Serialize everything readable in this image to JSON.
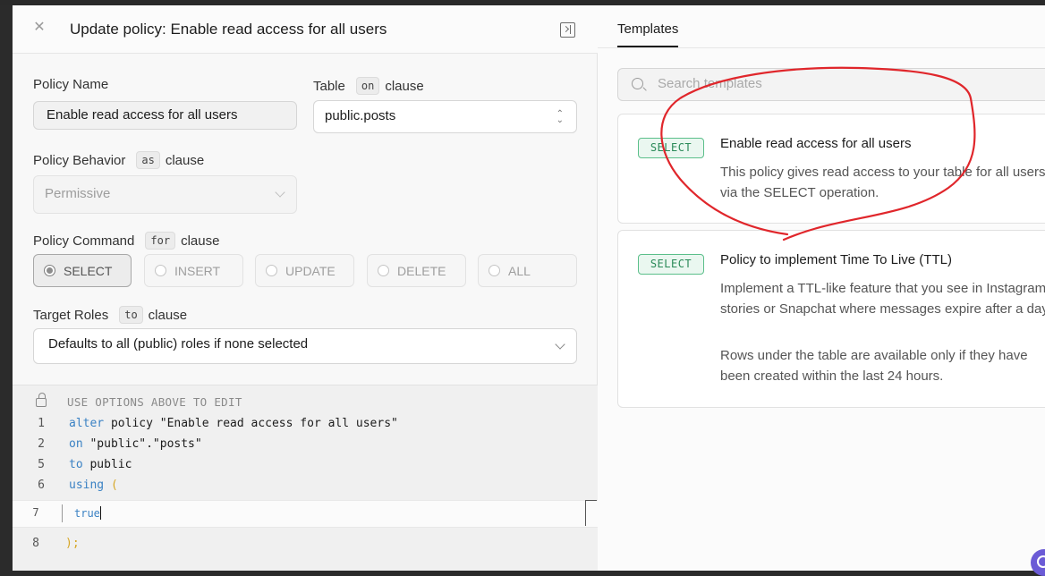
{
  "left_panel": {
    "title": "Update policy: Enable read access for all users",
    "policy_name_label": "Policy Name",
    "policy_name_value": "Enable read access for all users",
    "table_label": "Table",
    "table_kw": "on",
    "table_clause": "clause",
    "table_value": "public.posts",
    "behavior_label": "Policy Behavior",
    "behavior_kw": "as",
    "behavior_clause": "clause",
    "behavior_value": "Permissive",
    "command_label": "Policy Command",
    "command_kw": "for",
    "command_clause": "clause",
    "commands": [
      {
        "label": "SELECT",
        "selected": true
      },
      {
        "label": "INSERT",
        "selected": false
      },
      {
        "label": "UPDATE",
        "selected": false
      },
      {
        "label": "DELETE",
        "selected": false
      },
      {
        "label": "ALL",
        "selected": false
      }
    ],
    "roles_label": "Target Roles",
    "roles_kw": "to",
    "roles_clause": "clause",
    "roles_value": "Defaults to all (public) roles if none selected"
  },
  "editor": {
    "hint": "USE OPTIONS ABOVE TO EDIT",
    "lines": [
      {
        "num": "1",
        "kw": "alter",
        "rest": " policy \"Enable read access for all users\""
      },
      {
        "num": "2",
        "kw": "on",
        "rest": " \"public\".\"posts\""
      },
      {
        "num": "5",
        "kw": "to",
        "rest": " public"
      },
      {
        "num": "6",
        "kw": "using",
        "rest": " ("
      }
    ],
    "active_line": {
      "num": "7",
      "text": "true"
    },
    "last_line": {
      "num": "8",
      "text": ");"
    }
  },
  "right_panel": {
    "tab": "Templates",
    "search_placeholder": "Search templates",
    "templates": [
      {
        "badge": "SELECT",
        "title": "Enable read access for all users",
        "desc": "This policy gives read access to your table for all users via the SELECT operation."
      },
      {
        "badge": "SELECT",
        "title": "Policy to implement Time To Live (TTL)",
        "desc": "Implement a TTL-like feature that you see in Instagram stories or Snapchat where messages expire after a day.",
        "desc2": "Rows under the table are available only if they have been created within the last 24 hours."
      }
    ]
  },
  "colors": {
    "keyword": "#3b82c4",
    "paren": "#d7a726",
    "badge_border": "#5bbf8a",
    "annotation": "#e0262b"
  }
}
